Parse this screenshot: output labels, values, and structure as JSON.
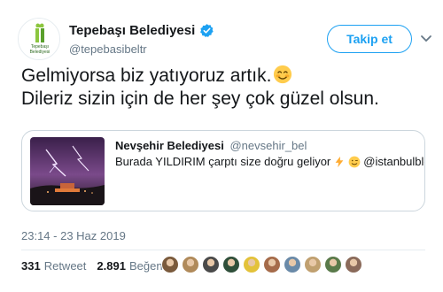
{
  "author": {
    "name": "Tepebaşı Belediyesi",
    "handle": "@tepebasibeltr",
    "avatar_icon": "tepebasi-logo-icon",
    "avatar_logo_text": [
      "Tepebaşı",
      "Belediyesi"
    ]
  },
  "follow_label": "Takip et",
  "tweet": {
    "line1": "Gelmiyorsa biz yatıyoruz artık.",
    "line2": "Dileriz sizin için de her şey çok güzel olsun.",
    "emoji": "smiling-face-icon"
  },
  "quote": {
    "name": "Nevşehir Belediyesi",
    "handle": "@nevsehir_bel",
    "text": "Burada YILDIRIM çarptı size doğru geliyor",
    "mention": "@istanbulbld",
    "emojis": [
      "lightning-icon",
      "winking-face-icon"
    ],
    "media": "lightning-night-photo"
  },
  "timestamp": "23:14 - 23 Haz 2019",
  "stats": {
    "retweets": "331",
    "retweets_label": "Retweet",
    "likes": "2.891",
    "likes_label": "Beğeni"
  },
  "likers": [
    {
      "color": "#7a5a3c"
    },
    {
      "color": "#b08a5a"
    },
    {
      "color": "#4a4a4a"
    },
    {
      "color": "#2f4f3a"
    },
    {
      "color": "#e3c23a"
    },
    {
      "color": "#a56b4a"
    },
    {
      "color": "#6a8aa8"
    },
    {
      "color": "#c0a070"
    },
    {
      "color": "#5a7a4a"
    },
    {
      "color": "#8a6a5a"
    }
  ],
  "colors": {
    "accent": "#1da1f2",
    "text": "#14171a",
    "muted": "#657786",
    "border": "#ccd6dd"
  }
}
